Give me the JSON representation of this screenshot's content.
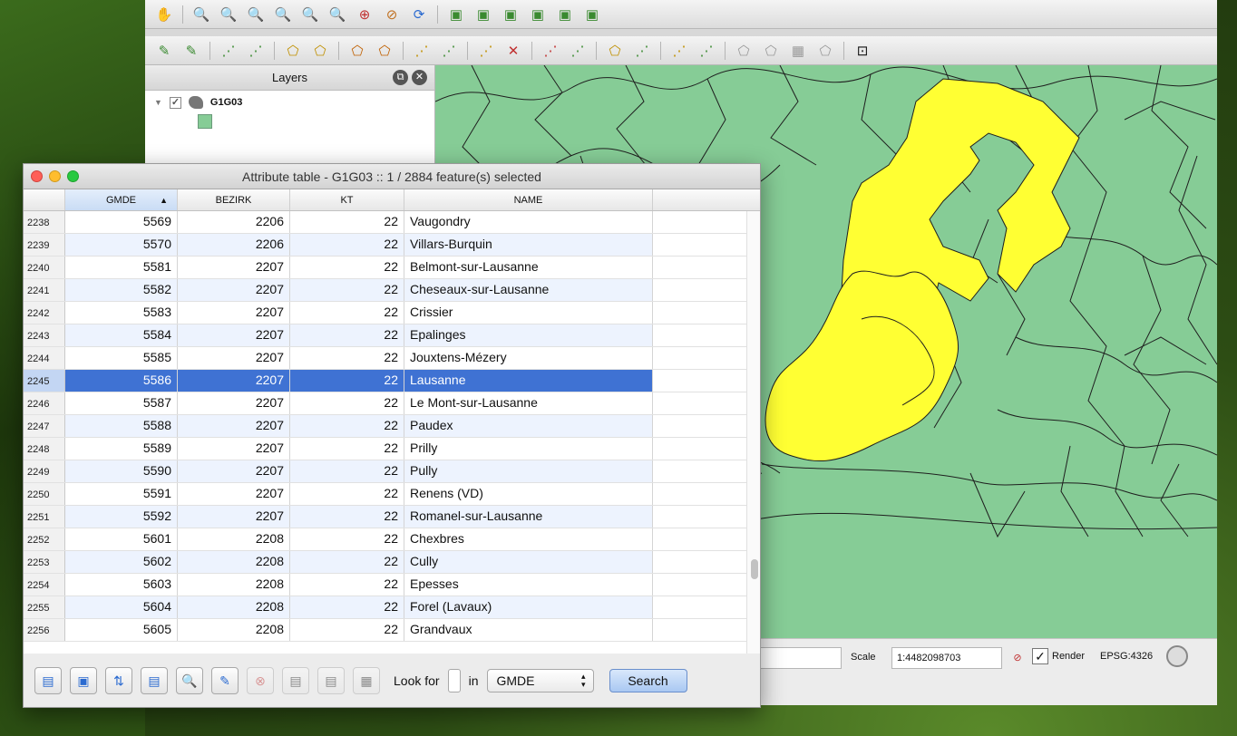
{
  "toolbar1": {
    "icons": [
      "pan-icon",
      "zoom-in-icon",
      "zoom-out-icon",
      "zoom-full-icon",
      "zoom-layer-icon",
      "zoom-selection-icon",
      "zoom-last-icon",
      "zoom-next-icon",
      "zoom-actual-icon",
      "refresh-icon",
      "new-bookmark-icon",
      "bookmarks-icon",
      "map-tips-icon",
      "measure-icon",
      "annotation-icon",
      "text-annotation-icon"
    ]
  },
  "toolbar2": {
    "icons": [
      "digitize-1-icon",
      "digitize-2-icon",
      "digitize-3-icon",
      "digitize-4-icon",
      "digitize-5-icon",
      "digitize-6-icon",
      "digitize-7-icon",
      "digitize-8-icon",
      "digitize-9-icon",
      "digitize-10-icon",
      "digitize-11-icon",
      "digitize-12-icon",
      "digitize-13-icon",
      "digitize-14-icon",
      "digitize-15-icon",
      "digitize-16-icon",
      "digitize-17-icon",
      "digitize-18-icon",
      "digitize-19-icon",
      "digitize-20-icon",
      "digitize-21-icon",
      "digitize-22-icon",
      "python-console-icon"
    ]
  },
  "layers": {
    "title": "Layers",
    "layer_name": "G1G03",
    "fill_color": "#86cc96"
  },
  "map": {
    "fill": "#86cc96",
    "selected_fill": "#ffff33"
  },
  "statusbar": {
    "scale_label": "Scale",
    "scale_value": "1:4482098703",
    "render_label": "Render",
    "crs": "EPSG:4326",
    "render_checked": "✓"
  },
  "attr": {
    "title": "Attribute table - G1G03 :: 1 / 2884 feature(s) selected",
    "columns": [
      "GMDE",
      "BEZIRK",
      "KT",
      "NAME"
    ],
    "rows": [
      {
        "rn": "2238",
        "gmde": "5569",
        "bezirk": "2206",
        "kt": "22",
        "name": "Vaugondry"
      },
      {
        "rn": "2239",
        "gmde": "5570",
        "bezirk": "2206",
        "kt": "22",
        "name": "Villars-Burquin"
      },
      {
        "rn": "2240",
        "gmde": "5581",
        "bezirk": "2207",
        "kt": "22",
        "name": "Belmont-sur-Lausanne"
      },
      {
        "rn": "2241",
        "gmde": "5582",
        "bezirk": "2207",
        "kt": "22",
        "name": "Cheseaux-sur-Lausanne"
      },
      {
        "rn": "2242",
        "gmde": "5583",
        "bezirk": "2207",
        "kt": "22",
        "name": "Crissier"
      },
      {
        "rn": "2243",
        "gmde": "5584",
        "bezirk": "2207",
        "kt": "22",
        "name": "Epalinges"
      },
      {
        "rn": "2244",
        "gmde": "5585",
        "bezirk": "2207",
        "kt": "22",
        "name": "Jouxtens-Mézery"
      },
      {
        "rn": "2245",
        "gmde": "5586",
        "bezirk": "2207",
        "kt": "22",
        "name": "Lausanne"
      },
      {
        "rn": "2246",
        "gmde": "5587",
        "bezirk": "2207",
        "kt": "22",
        "name": "Le Mont-sur-Lausanne"
      },
      {
        "rn": "2247",
        "gmde": "5588",
        "bezirk": "2207",
        "kt": "22",
        "name": "Paudex"
      },
      {
        "rn": "2248",
        "gmde": "5589",
        "bezirk": "2207",
        "kt": "22",
        "name": "Prilly"
      },
      {
        "rn": "2249",
        "gmde": "5590",
        "bezirk": "2207",
        "kt": "22",
        "name": "Pully"
      },
      {
        "rn": "2250",
        "gmde": "5591",
        "bezirk": "2207",
        "kt": "22",
        "name": "Renens (VD)"
      },
      {
        "rn": "2251",
        "gmde": "5592",
        "bezirk": "2207",
        "kt": "22",
        "name": "Romanel-sur-Lausanne"
      },
      {
        "rn": "2252",
        "gmde": "5601",
        "bezirk": "2208",
        "kt": "22",
        "name": "Chexbres"
      },
      {
        "rn": "2253",
        "gmde": "5602",
        "bezirk": "2208",
        "kt": "22",
        "name": "Cully"
      },
      {
        "rn": "2254",
        "gmde": "5603",
        "bezirk": "2208",
        "kt": "22",
        "name": "Epesses"
      },
      {
        "rn": "2255",
        "gmde": "5604",
        "bezirk": "2208",
        "kt": "22",
        "name": "Forel (Lavaux)"
      },
      {
        "rn": "2256",
        "gmde": "5605",
        "bezirk": "2208",
        "kt": "22",
        "name": "Grandvaux"
      }
    ],
    "selected_row": "2245",
    "look_for_label": "Look for",
    "in_label": "in",
    "field_select": "GMDE",
    "search_label": "Search",
    "bottom_icons": [
      "open-table-icon",
      "select-all-icon",
      "invert-selection-icon",
      "move-selection-top-icon",
      "zoom-to-selection-icon",
      "edit-pencil-icon",
      "delete-selected-icon",
      "new-column-icon",
      "delete-column-icon",
      "field-calculator-icon"
    ]
  }
}
